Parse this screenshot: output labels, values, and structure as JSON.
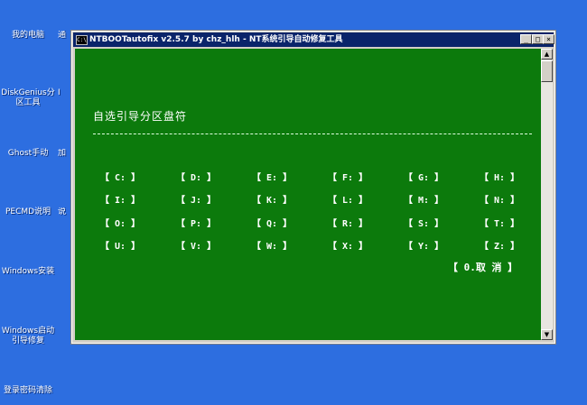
{
  "desktop": {
    "icons": [
      {
        "label": "我的电脑"
      },
      {
        "label": "DiskGenius分区工具"
      },
      {
        "label": "Ghost手动"
      },
      {
        "label": "PECMD说明"
      },
      {
        "label": "Windows安装"
      },
      {
        "label": "Windows启动引导修复"
      },
      {
        "label": "登录密码清除"
      }
    ],
    "second_column": [
      "通",
      "I",
      "加",
      "说"
    ]
  },
  "window": {
    "icon_text": "C:\\",
    "title": "NTBOOTautofix v2.5.7 by chz_hlh - NT系统引导自动修复工具",
    "minimize": "_",
    "maximize": "□",
    "close": "×",
    "heading": "自选引导分区盘符",
    "drives": [
      [
        "【 C: 】",
        "【 D: 】",
        "【 E: 】",
        "【 F: 】",
        "【 G: 】",
        "【 H: 】"
      ],
      [
        "【 I: 】",
        "【 J: 】",
        "【 K: 】",
        "【 L: 】",
        "【 M: 】",
        "【 N: 】"
      ],
      [
        "【 O: 】",
        "【 P: 】",
        "【 Q: 】",
        "【 R: 】",
        "【 S: 】",
        "【 T: 】"
      ],
      [
        "【 U: 】",
        "【 V: 】",
        "【 W: 】",
        "【 X: 】",
        "【 Y: 】",
        "【 Z: 】"
      ]
    ],
    "cancel": "【 0.取  消 】",
    "scroll_up": "▲",
    "scroll_down": "▼"
  },
  "colors": {
    "desktop_bg": "#2d6ee0",
    "console_bg": "#0c7a0c",
    "titlebar": "#0a246a"
  }
}
